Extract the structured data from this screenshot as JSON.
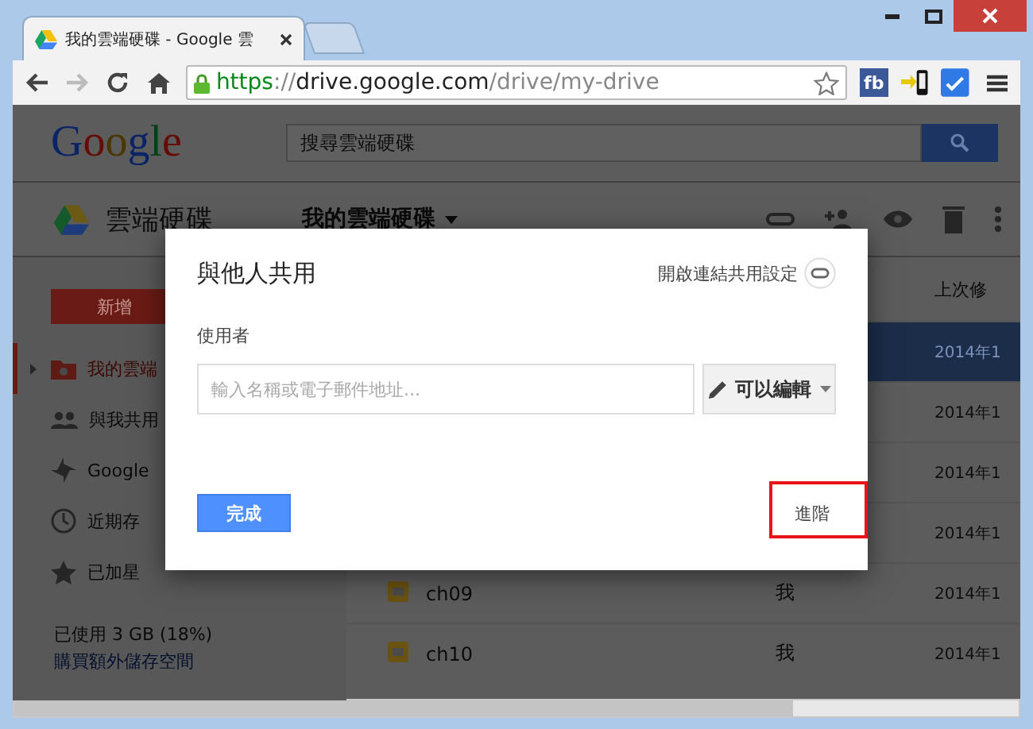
{
  "browser": {
    "tab_title": "我的雲端硬碟 - Google 雲",
    "url": "https://drive.google.com/drive/my-drive",
    "extensions": [
      {
        "kind": "fb",
        "label": "fb"
      },
      {
        "kind": "phone"
      },
      {
        "kind": "check"
      }
    ]
  },
  "drive": {
    "logo": "Google",
    "search_placeholder": "搜尋雲端硬碟",
    "app_name": "雲端硬碟",
    "breadcrumb": "我的雲端硬碟",
    "new_button": "新增",
    "sidebar_items": [
      {
        "kind": "folder",
        "label": "我的雲端",
        "selected": true
      },
      {
        "kind": "people",
        "label": "與我共用",
        "selected": false
      },
      {
        "kind": "photos",
        "label": "Google",
        "selected": false
      },
      {
        "kind": "clock",
        "label": "近期存",
        "selected": false
      },
      {
        "kind": "star",
        "label": "已加星",
        "selected": false
      }
    ],
    "storage_used": "已使用 3 GB (18%)",
    "storage_link": "購買額外儲存空間",
    "columns": [
      "上次修"
    ],
    "rows": [
      {
        "modified": "2014年1",
        "selected": true
      },
      {
        "modified": "2014年1",
        "selected": false
      },
      {
        "modified": "2014年1",
        "selected": false
      },
      {
        "modified": "2014年1",
        "selected": false
      },
      {
        "name": "ch09",
        "owner": "我",
        "modified": "2014年1",
        "selected": false
      },
      {
        "name": "ch10",
        "owner": "我",
        "modified": "2014年1",
        "selected": false
      }
    ]
  },
  "modal": {
    "title": "與他人共用",
    "link_sharing": "開啟連結共用設定",
    "people_label": "使用者",
    "input_placeholder": "輸入名稱或電子郵件地址...",
    "permission": "可以編輯",
    "done": "完成",
    "advanced": "進階",
    "advanced_highlighted": true
  }
}
